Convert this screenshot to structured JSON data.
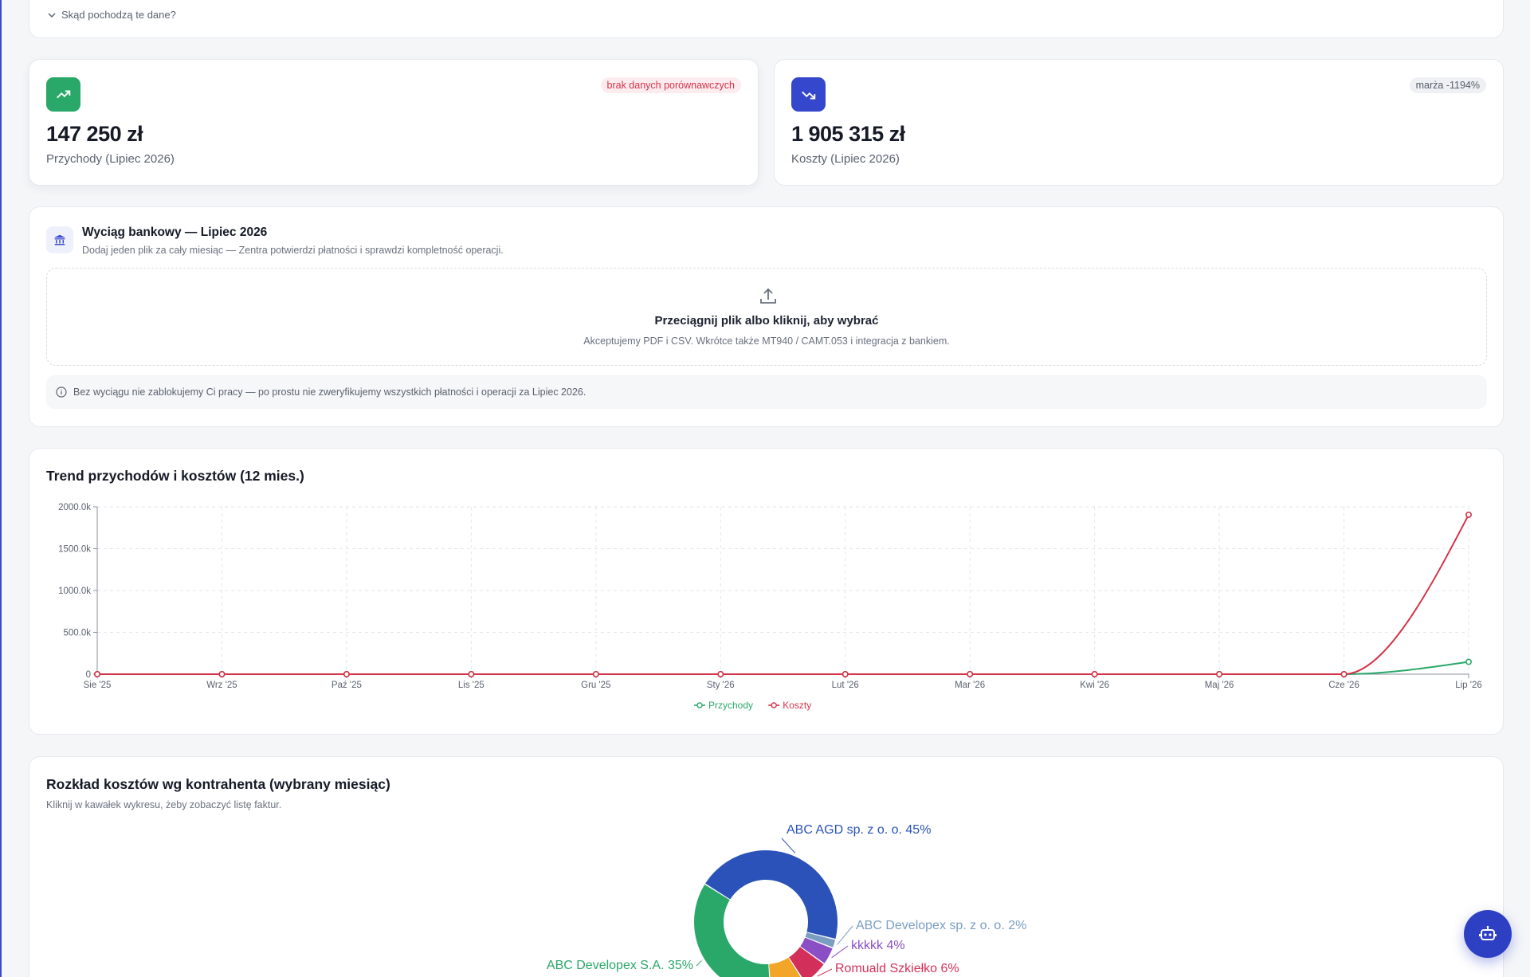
{
  "source_toggle": {
    "label": "Skąd pochodzą te dane?"
  },
  "stats": {
    "income": {
      "value": "147 250 zł",
      "label": "Przychody (Lipiec 2026)",
      "badge": "brak danych porównawczych",
      "icon": "trending-up-icon",
      "color": "#2aa869"
    },
    "costs": {
      "value": "1 905 315 zł",
      "label": "Koszty (Lipiec 2026)",
      "badge": "marża -1194%",
      "icon": "trending-down-icon",
      "color": "#3547cc"
    }
  },
  "bank": {
    "title": "Wyciąg bankowy — Lipiec 2026",
    "subtitle": "Dodaj jeden plik za cały miesiąc — Zentra potwierdzi płatności i sprawdzi kompletność operacji.",
    "dropzone_title": "Przeciągnij plik albo kliknij, aby wybrać",
    "dropzone_subtitle": "Akceptujemy PDF i CSV. Wkrótce także MT940 / CAMT.053 i integracja z bankiem.",
    "note": "Bez wyciągu nie zablokujemy Ci pracy — po prostu nie zweryfikujemy wszystkich płatności i operacji za Lipiec 2026."
  },
  "trend": {
    "title": "Trend przychodów i kosztów (12 mies.)",
    "chart_data": {
      "type": "line",
      "categories": [
        "Sie '25",
        "Wrz '25",
        "Paź '25",
        "Lis '25",
        "Gru '25",
        "Sty '26",
        "Lut '26",
        "Mar '26",
        "Kwi '26",
        "Maj '26",
        "Cze '26",
        "Lip '26"
      ],
      "series": [
        {
          "name": "Przychody",
          "color": "#2aa869",
          "values": [
            0,
            0,
            0,
            0,
            0,
            0,
            0,
            0,
            0,
            0,
            0,
            147250
          ]
        },
        {
          "name": "Koszty",
          "color": "#d5334a",
          "values": [
            0,
            0,
            0,
            0,
            0,
            0,
            0,
            0,
            0,
            0,
            0,
            1905315
          ]
        }
      ],
      "y_ticks": [
        "0",
        "500.0k",
        "1000.0k",
        "1500.0k",
        "2000.0k"
      ],
      "y_tick_values": [
        0,
        500000,
        1000000,
        1500000,
        2000000
      ],
      "ylim": [
        0,
        2000000
      ],
      "grid": true,
      "legend": "bottom-center"
    }
  },
  "costs_pie": {
    "title": "Rozkład kosztów wg kontrahenta (wybrany miesiąc)",
    "subtitle": "Kliknij w kawałek wykresu, żeby zobaczyć listę faktur.",
    "chart_data": {
      "type": "pie",
      "slices": [
        {
          "label": "ABC AGD sp. z o. o. 45%",
          "value": 45,
          "color": "#2a52b8"
        },
        {
          "label": "ABC Developex sp. z o. o. 2%",
          "value": 2,
          "color": "#7a9ec2"
        },
        {
          "label": "kkkkk 4%",
          "value": 4,
          "color": "#8a4fc4"
        },
        {
          "label": "Romuald Szkiełko 6%",
          "value": 6,
          "color": "#d2305a"
        },
        {
          "label": "",
          "value": 8,
          "color": "#f2a526"
        },
        {
          "label": "ABC Developex S.A. 35%",
          "value": 35,
          "color": "#2aa869"
        }
      ]
    }
  },
  "assistant": {
    "icon": "robot-icon"
  }
}
